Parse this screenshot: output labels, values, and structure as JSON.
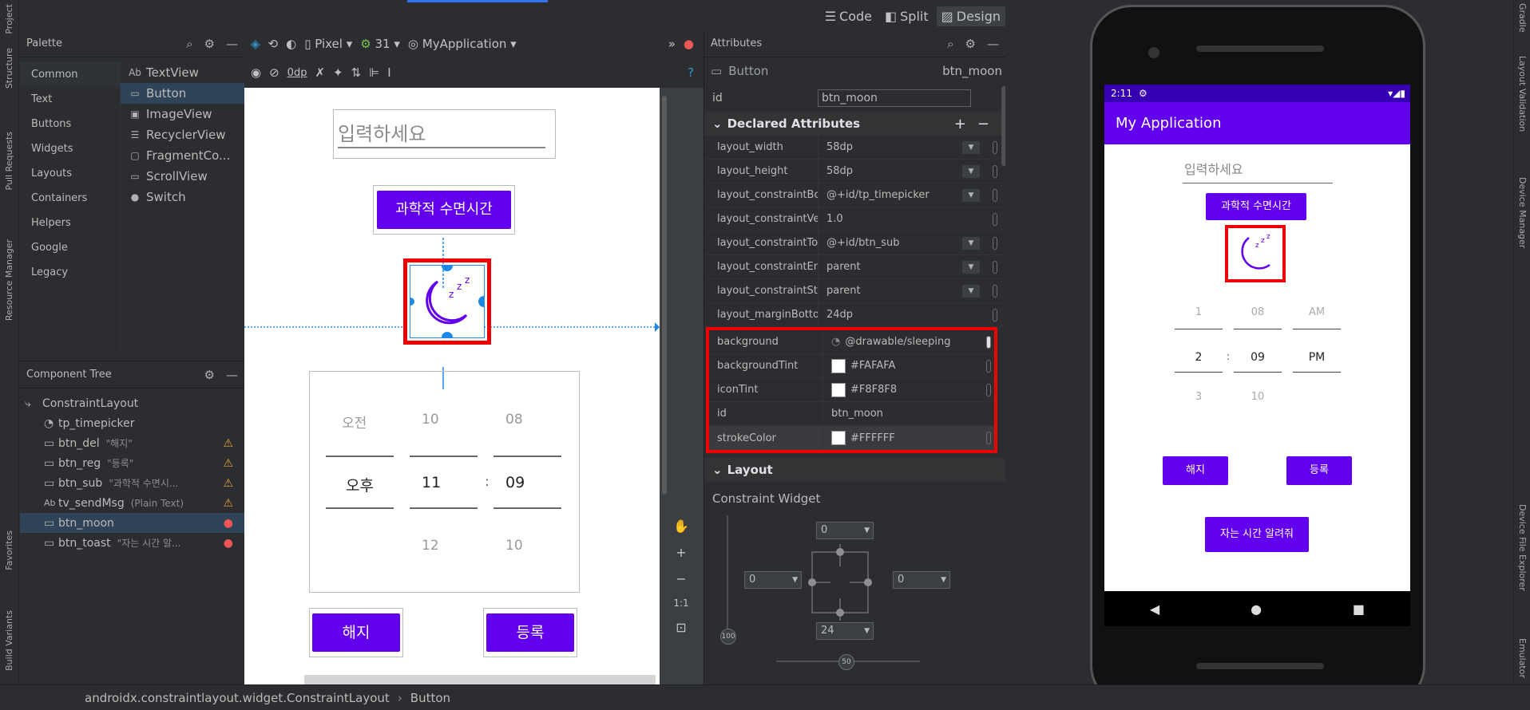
{
  "left_strip": [
    "Project",
    "Structure",
    "Pull Requests",
    "Resource Manager",
    "Favorites",
    "Build Variants"
  ],
  "right_strip": [
    "Gradle",
    "Layout Validation",
    "Device Manager",
    "Device File Explorer",
    "Emulator"
  ],
  "view_modes": {
    "code": "Code",
    "split": "Split",
    "design": "Design"
  },
  "palette": {
    "title": "Palette",
    "categories": [
      "Common",
      "Text",
      "Buttons",
      "Widgets",
      "Layouts",
      "Containers",
      "Helpers",
      "Google",
      "Legacy"
    ],
    "items": [
      {
        "icon": "Ab",
        "label": "TextView"
      },
      {
        "icon": "▭",
        "label": "Button"
      },
      {
        "icon": "▣",
        "label": "ImageView"
      },
      {
        "icon": "☰",
        "label": "RecyclerView"
      },
      {
        "icon": "▢",
        "label": "FragmentCo..."
      },
      {
        "icon": "▭",
        "label": "ScrollView"
      },
      {
        "icon": "●",
        "label": "Switch"
      }
    ]
  },
  "toolbar": {
    "device": "Pixel",
    "api": "31",
    "theme": "MyApplication",
    "margin": "0dp"
  },
  "component_tree": {
    "title": "Component Tree",
    "rows": [
      {
        "name": "ConstraintLayout",
        "sub": "",
        "status": ""
      },
      {
        "name": "tp_timepicker",
        "sub": "",
        "status": ""
      },
      {
        "name": "btn_del",
        "sub": "\"해지\"",
        "status": "warn"
      },
      {
        "name": "btn_reg",
        "sub": "\"등록\"",
        "status": "warn"
      },
      {
        "name": "btn_sub",
        "sub": "\"과학적 수면시...",
        "status": "warn"
      },
      {
        "name": "tv_sendMsg",
        "sub": "(Plain Text)",
        "status": "warn"
      },
      {
        "name": "btn_moon",
        "sub": "",
        "status": "err"
      },
      {
        "name": "btn_toast",
        "sub": "\"자는 시간 알...",
        "status": "err"
      }
    ]
  },
  "design": {
    "hint": "입력하세요",
    "btn_sub": "과학적 수면시간",
    "picker": {
      "ampm": [
        "오전",
        "오후",
        ""
      ],
      "hours": [
        "10",
        "11",
        "12"
      ],
      "mins": [
        "08",
        "09",
        "10"
      ],
      "sep": ":"
    },
    "btn_del": "해지",
    "btn_reg": "등록"
  },
  "attributes": {
    "title": "Attributes",
    "widget": "Button",
    "widget_id": "btn_moon",
    "id_label": "id",
    "id_value": "btn_moon",
    "declared_title": "Declared Attributes",
    "declared": [
      {
        "k": "layout_width",
        "v": "58dp",
        "dd": true
      },
      {
        "k": "layout_height",
        "v": "58dp",
        "dd": true
      },
      {
        "k": "layout_constraintBot...",
        "v": "@+id/tp_timepicker",
        "dd": true
      },
      {
        "k": "layout_constraintVe...",
        "v": "1.0",
        "dd": false
      },
      {
        "k": "layout_constraintTo...",
        "v": "@+id/btn_sub",
        "dd": true
      },
      {
        "k": "layout_constraintEn...",
        "v": "parent",
        "dd": true
      },
      {
        "k": "layout_constraintSta...",
        "v": "parent",
        "dd": true
      },
      {
        "k": "layout_marginBotto...",
        "v": "24dp",
        "dd": false
      }
    ],
    "highlighted": [
      {
        "k": "background",
        "v": "@drawable/sleeping",
        "swatch": false
      },
      {
        "k": "backgroundTint",
        "v": "#FAFAFA",
        "swatch": true
      },
      {
        "k": "iconTint",
        "v": "#F8F8F8",
        "swatch": true
      },
      {
        "k": "id",
        "v": "btn_moon",
        "swatch": false
      },
      {
        "k": "strokeColor",
        "v": "#FFFFFF",
        "swatch": true
      }
    ],
    "layout_title": "Layout",
    "constraint_widget": "Constraint Widget",
    "cw": {
      "top": "0",
      "left": "0",
      "right": "0",
      "bottom": "24",
      "bias_v": "100",
      "bias_h": "50"
    }
  },
  "emulator": {
    "time": "2:11",
    "app_title": "My Application",
    "hint": "입력하세요",
    "btn_sub": "과학적 수면시간",
    "picker": {
      "h": [
        "1",
        "2",
        "3"
      ],
      "m": [
        "08",
        "09",
        "10"
      ],
      "p": [
        "AM",
        "PM",
        ""
      ],
      "sep": ":"
    },
    "btn_del": "해지",
    "btn_reg": "등록",
    "btn_toast": "자는 시간 알려줘"
  },
  "breadcrumb": {
    "root": "androidx.constraintlayout.widget.ConstraintLayout",
    "sep": "›",
    "leaf": "Button"
  }
}
